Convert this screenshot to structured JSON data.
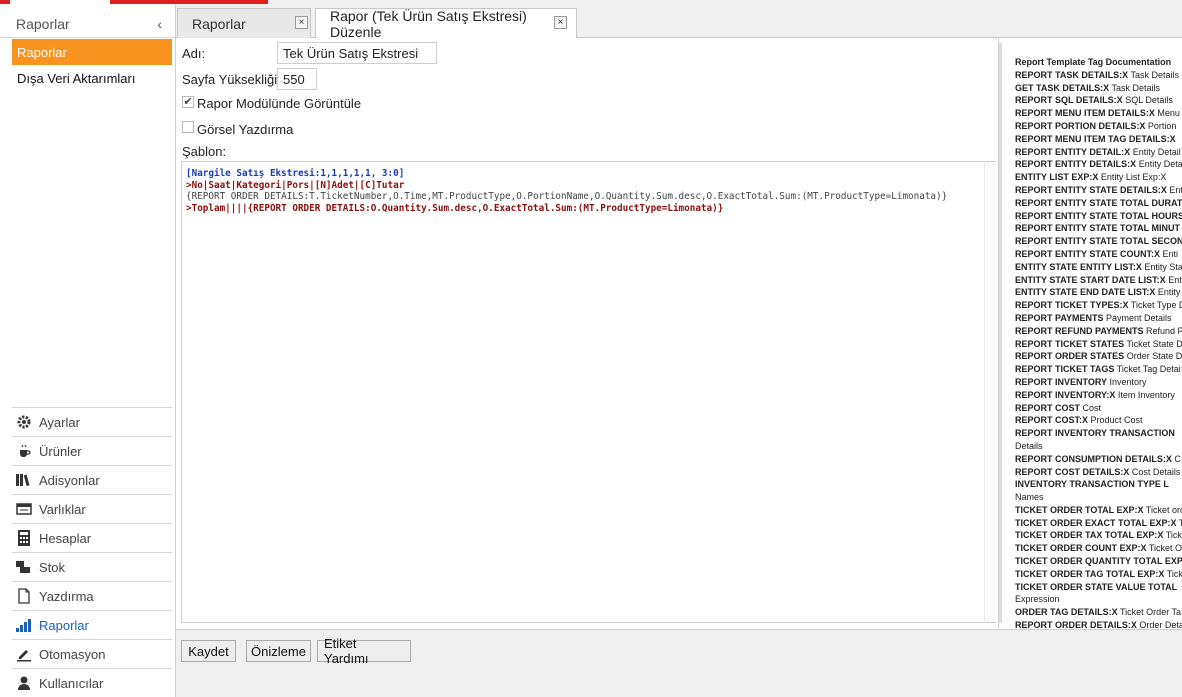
{
  "sidebar": {
    "header": "Raporlar",
    "chevron": "‹",
    "items": [
      {
        "label": "Raporlar",
        "active": true
      },
      {
        "label": "Dışa Veri Aktarımları",
        "active": false
      }
    ],
    "nav": [
      {
        "label": "Ayarlar",
        "icon": "gear-icon"
      },
      {
        "label": "Ürünler",
        "icon": "coffee-icon"
      },
      {
        "label": "Adisyonlar",
        "icon": "books-icon"
      },
      {
        "label": "Varlıklar",
        "icon": "table-icon"
      },
      {
        "label": "Hesaplar",
        "icon": "calculator-icon"
      },
      {
        "label": "Stok",
        "icon": "stock-icon"
      },
      {
        "label": "Yazdırma",
        "icon": "document-icon"
      },
      {
        "label": "Raporlar",
        "icon": "bar-chart-icon",
        "active": true
      },
      {
        "label": "Otomasyon",
        "icon": "pencil-icon"
      },
      {
        "label": "Kullanıcılar",
        "icon": "user-icon"
      }
    ]
  },
  "tabs": [
    {
      "label": "Raporlar",
      "close": "×"
    },
    {
      "label": "Rapor (Tek Ürün Satış Ekstresi) Düzenle",
      "close": "×"
    }
  ],
  "form": {
    "name_label": "Adı:",
    "name_value": "Tek Ürün Satış Ekstresi",
    "height_label": "Sayfa Yüksekliği:",
    "height_value": "550",
    "show_in_module_label": "Rapor Modülünde Görüntüle",
    "show_in_module_checked": true,
    "visual_print_label": "Görsel Yazdırma",
    "visual_print_checked": false,
    "template_label": "Şablon:",
    "checkmark": "✔"
  },
  "template_lines": [
    "[Nargile Satış Ekstresi:1,1,1,1,1, 3:0]",
    ">No|Saat|Kategori|Pors|[N]Adet|[C]Tutar",
    "{REPORT ORDER DETAILS:T.TicketNumber,O.Time,MT.ProductType,O.PortionName,O.Quantity.Sum.desc,O.ExactTotal.Sum:(MT.ProductType=Limonata)}",
    ">Toplam||||{REPORT ORDER DETAILS:O.Quantity.Sum.desc,O.ExactTotal.Sum:(MT.ProductType=Limonata)}"
  ],
  "buttons": {
    "save": "Kaydet",
    "preview": "Önizleme",
    "tag_help": "Etiket Yardımı"
  },
  "doc": [
    {
      "tag": "Report Template Tag Documentation",
      "desc": ""
    },
    {
      "tag": "REPORT TASK DETAILS:X",
      "desc": "Task Details"
    },
    {
      "tag": "GET TASK DETAILS:X",
      "desc": "Task Details"
    },
    {
      "tag": "REPORT SQL DETAILS:X",
      "desc": "SQL Details"
    },
    {
      "tag": "REPORT MENU ITEM DETAILS:X",
      "desc": "Menu"
    },
    {
      "tag": "REPORT PORTION DETAILS:X",
      "desc": "Portion"
    },
    {
      "tag": "REPORT MENU ITEM TAG DETAILS:X",
      "desc": ""
    },
    {
      "tag": "REPORT ENTITY DETAIL:X",
      "desc": "Entity Detail"
    },
    {
      "tag": "REPORT ENTITY DETAILS:X",
      "desc": "Entity Deta"
    },
    {
      "tag": "ENTITY LIST EXP:X",
      "desc": "Entity List Exp:X"
    },
    {
      "tag": "REPORT ENTITY STATE DETAILS:X",
      "desc": "Ent"
    },
    {
      "tag": "REPORT ENTITY STATE TOTAL DURAT",
      "desc": ""
    },
    {
      "tag": "REPORT ENTITY STATE TOTAL HOURS",
      "desc": ""
    },
    {
      "tag": "REPORT ENTITY STATE TOTAL MINUT",
      "desc": ""
    },
    {
      "tag": "REPORT ENTITY STATE TOTAL SECON",
      "desc": ""
    },
    {
      "tag": "REPORT ENTITY STATE COUNT:X",
      "desc": "Enti"
    },
    {
      "tag": "ENTITY STATE ENTITY LIST:X",
      "desc": "Entity Sta"
    },
    {
      "tag": "ENTITY STATE START DATE LIST:X",
      "desc": "Ent"
    },
    {
      "tag": "ENTITY STATE END DATE LIST:X",
      "desc": "Entity"
    },
    {
      "tag": "REPORT TICKET TYPES:X",
      "desc": "Ticket Type D"
    },
    {
      "tag": "REPORT PAYMENTS",
      "desc": "Payment Details"
    },
    {
      "tag": "REPORT REFUND PAYMENTS",
      "desc": "Refund P"
    },
    {
      "tag": "REPORT TICKET STATES",
      "desc": "Ticket State D"
    },
    {
      "tag": "REPORT ORDER STATES",
      "desc": "Order State D"
    },
    {
      "tag": "REPORT TICKET TAGS",
      "desc": "Ticket Tag Detai"
    },
    {
      "tag": "REPORT INVENTORY",
      "desc": "Inventory"
    },
    {
      "tag": "REPORT INVENTORY:X",
      "desc": "Item Inventory"
    },
    {
      "tag": "REPORT COST",
      "desc": "Cost"
    },
    {
      "tag": "REPORT COST:X",
      "desc": "Product Cost"
    },
    {
      "tag": "REPORT INVENTORY TRANSACTION",
      "desc": ""
    },
    {
      "tag": "",
      "desc": "Details"
    },
    {
      "tag": "REPORT CONSUMPTION DETAILS:X",
      "desc": "C"
    },
    {
      "tag": "REPORT COST DETAILS:X",
      "desc": "Cost Details"
    },
    {
      "tag": "INVENTORY  TRANSACTION  TYPE  L",
      "desc": ""
    },
    {
      "tag": "",
      "desc": "Names"
    },
    {
      "tag": "TICKET ORDER TOTAL EXP:X",
      "desc": "Ticket ord"
    },
    {
      "tag": "TICKET ORDER EXACT TOTAL EXP:X",
      "desc": "T"
    },
    {
      "tag": "TICKET ORDER TAX TOTAL EXP:X",
      "desc": "Tick"
    },
    {
      "tag": "TICKET ORDER COUNT EXP:X",
      "desc": "Ticket O"
    },
    {
      "tag": "TICKET ORDER QUANTITY TOTAL EXP",
      "desc": ""
    },
    {
      "tag": "TICKET ORDER TAG TOTAL EXP:X",
      "desc": "Tick"
    },
    {
      "tag": "TICKET  ORDER  STATE  VALUE  TOTAL",
      "desc": ""
    },
    {
      "tag": "",
      "desc": "Expression"
    },
    {
      "tag": "ORDER TAG DETAILS:X",
      "desc": "Ticket Order Ta"
    },
    {
      "tag": "REPORT ORDER DETAILS:X",
      "desc": "Order Deta"
    }
  ]
}
